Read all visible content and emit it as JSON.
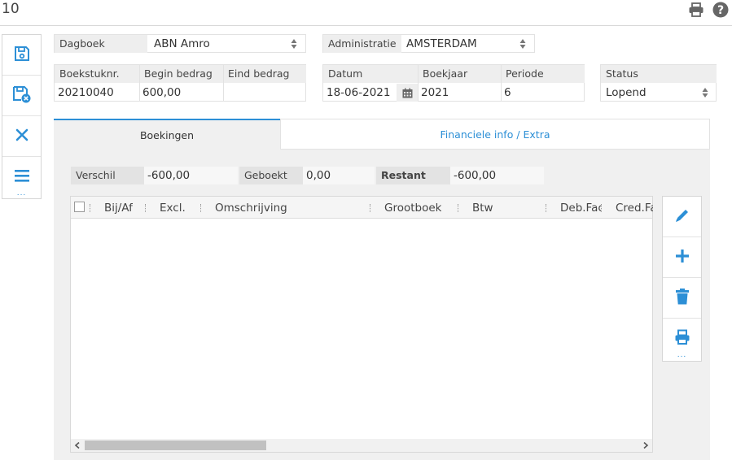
{
  "header": {
    "title": "10",
    "print_icon": "print-icon",
    "help_icon": "help-icon"
  },
  "left_toolbar": {
    "items": [
      "save-icon",
      "save-close-icon",
      "close-icon",
      "menu-icon"
    ],
    "more": "..."
  },
  "fields": {
    "dagboek": {
      "label": "Dagboek",
      "value": "ABN Amro"
    },
    "administratie": {
      "label": "Administratie",
      "value": "AMSTERDAM"
    },
    "boekstuknr": {
      "label": "Boekstuknr.",
      "value": "20210040"
    },
    "begin_bedrag": {
      "label": "Begin bedrag",
      "value": "600,00"
    },
    "eind_bedrag": {
      "label": "Eind bedrag",
      "value": ""
    },
    "datum": {
      "label": "Datum",
      "value": "18-06-2021"
    },
    "boekjaar": {
      "label": "Boekjaar",
      "value": "2021"
    },
    "periode": {
      "label": "Periode",
      "value": "6"
    },
    "status": {
      "label": "Status",
      "value": "Lopend"
    }
  },
  "tabs": [
    {
      "label": "Boekingen",
      "active": true
    },
    {
      "label": "Financiele info / Extra",
      "active": false
    }
  ],
  "summary": {
    "verschil": {
      "label": "Verschil",
      "value": "-600,00"
    },
    "geboekt": {
      "label": "Geboekt",
      "value": "0,00"
    },
    "restant": {
      "label": "Restant",
      "value": "-600,00"
    }
  },
  "grid": {
    "columns": [
      "Bij/Af",
      "Excl.",
      "Omschrijving",
      "Grootboek",
      "Btw",
      "Deb.Fac",
      "Cred.Fa"
    ],
    "rows": []
  },
  "right_toolbar": {
    "items": [
      "edit-icon",
      "add-icon",
      "delete-icon",
      "print-icon"
    ],
    "more": "..."
  },
  "colors": {
    "accent": "#2c8fd6",
    "panel_bg": "#f0f0f0",
    "label_bg": "#eeeeee"
  }
}
